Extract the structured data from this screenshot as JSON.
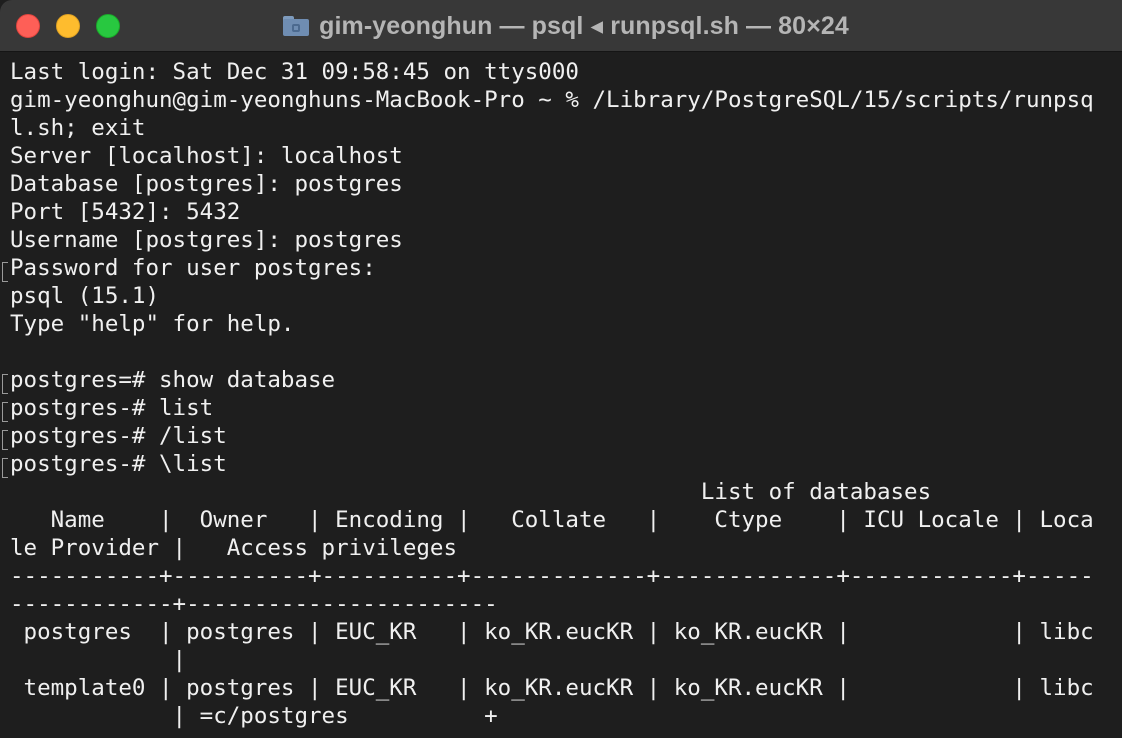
{
  "window": {
    "title": "gim-yeonghun — psql ◂ runpsql.sh — 80×24"
  },
  "terminal": {
    "lines": [
      "Last login: Sat Dec 31 09:58:45 on ttys000",
      "gim-yeonghun@gim-yeonghuns-MacBook-Pro ~ % /Library/PostgreSQL/15/scripts/runpsq",
      "l.sh; exit",
      "Server [localhost]: localhost",
      "Database [postgres]: postgres",
      "Port [5432]: 5432",
      "Username [postgres]: postgres",
      "Password for user postgres:",
      "psql (15.1)",
      "Type \"help\" for help.",
      "",
      "postgres=# show database",
      "postgres-# list",
      "postgres-# /list",
      "postgres-# \\list",
      "                                                   List of databases",
      "   Name    |  Owner   | Encoding |   Collate   |    Ctype    | ICU Locale | Loca",
      "le Provider |   Access privileges",
      "-----------+----------+----------+-------------+-------------+------------+-----",
      "------------+-----------------------",
      " postgres  | postgres | EUC_KR   | ko_KR.eucKR | ko_KR.eucKR |            | libc",
      "            |",
      " template0 | postgres | EUC_KR   | ko_KR.eucKR | ko_KR.eucKR |            | libc",
      "            | =c/postgres          +"
    ]
  }
}
